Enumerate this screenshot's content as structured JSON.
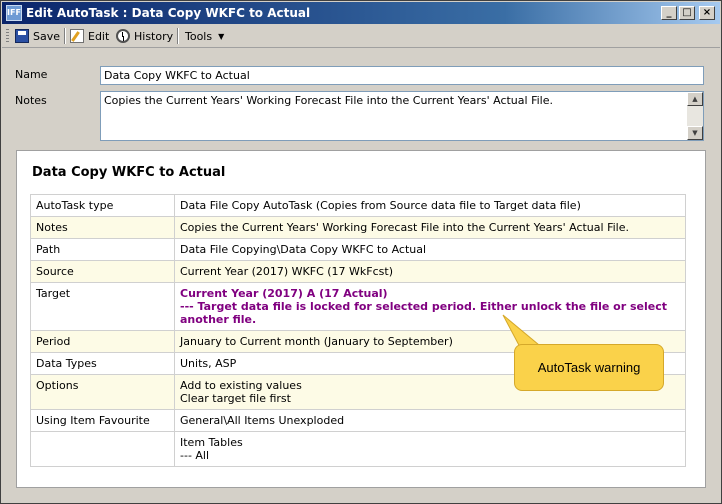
{
  "window": {
    "icon_text": "IFF",
    "title": "Edit AutoTask : Data Copy WKFC to Actual",
    "minimize": "_",
    "maximize": "□",
    "close": "×"
  },
  "toolbar": {
    "save_label": "Save",
    "edit_label": "Edit",
    "history_label": "History",
    "tools_label": "Tools",
    "tools_caret": "▼"
  },
  "form": {
    "name_label": "Name",
    "name_value": "Data Copy WKFC to Actual",
    "notes_label": "Notes",
    "notes_value": "Copies the Current Years' Working Forecast File into the Current Years' Actual File.",
    "scroll_up": "▲",
    "scroll_down": "▼"
  },
  "details": {
    "title": "Data Copy WKFC to Actual",
    "rows": [
      {
        "label": "AutoTask type",
        "value": "Data File Copy AutoTask (Copies from Source data file to Target data file)"
      },
      {
        "label": "Notes",
        "value": "Copies the Current Years' Working Forecast File into the Current Years' Actual File."
      },
      {
        "label": "Path",
        "value": "Data File Copying\\Data Copy WKFC to Actual"
      },
      {
        "label": "Source",
        "value": "Current Year (2017) WKFC (17 WkFcst)"
      },
      {
        "label": "Target",
        "value": "Current Year (2017) A (17 Actual)",
        "warning": "--- Target data file is locked for selected period. Either unlock the file or select another file."
      },
      {
        "label": "Period",
        "value": "January to Current month (January to September)"
      },
      {
        "label": "Data Types",
        "value": "Units, ASP"
      },
      {
        "label": "Options",
        "value": "Add to existing values",
        "value2": "Clear target file first"
      },
      {
        "label": "Using Item Favourite",
        "value": "General\\All Items Unexploded"
      },
      {
        "label": "",
        "value": "Item Tables",
        "value2": "--- All"
      }
    ]
  },
  "callout": {
    "text": "AutoTask warning"
  },
  "colors": {
    "title_bar_start": "#0a246a",
    "warning_text": "#800080",
    "callout_fill": "#fad24a",
    "alt_row": "#fdfbe6"
  }
}
